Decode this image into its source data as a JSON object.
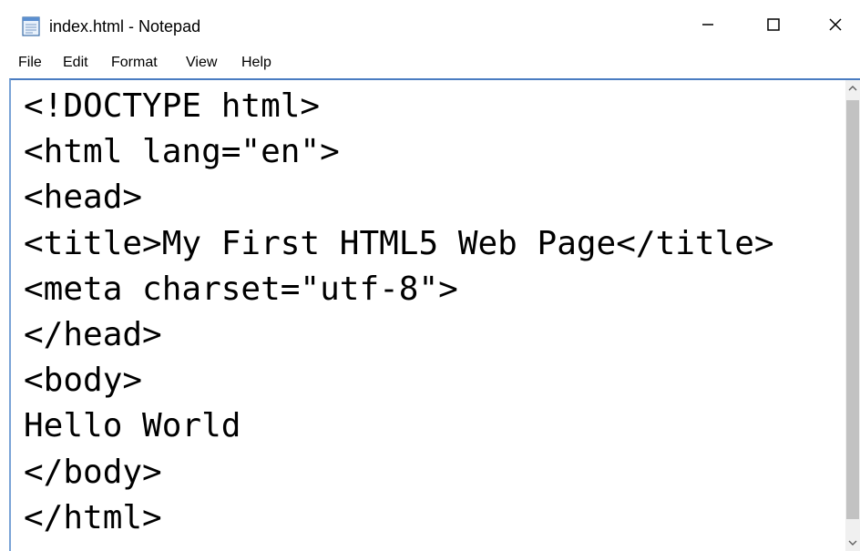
{
  "window": {
    "title": "index.html - Notepad",
    "icon": "notepad-icon",
    "controls": {
      "minimize_icon": "minimize-icon",
      "maximize_icon": "maximize-icon",
      "close_icon": "close-icon"
    }
  },
  "menu": {
    "items": [
      {
        "label": "File"
      },
      {
        "label": "Edit"
      },
      {
        "label": "Format"
      },
      {
        "label": "View"
      },
      {
        "label": "Help"
      }
    ]
  },
  "editor": {
    "lines": [
      "<!DOCTYPE html>",
      "<html lang=\"en\">",
      "<head>",
      "<title>My First HTML5 Web Page</title>",
      "<meta charset=\"utf-8\">",
      "</head>",
      "<body>",
      "Hello World",
      "</body>",
      "</html>"
    ]
  },
  "colors": {
    "accent_border": "#4a7cc1",
    "scroll_thumb": "#c2c2c2",
    "scroll_track": "#f0f0f0"
  }
}
